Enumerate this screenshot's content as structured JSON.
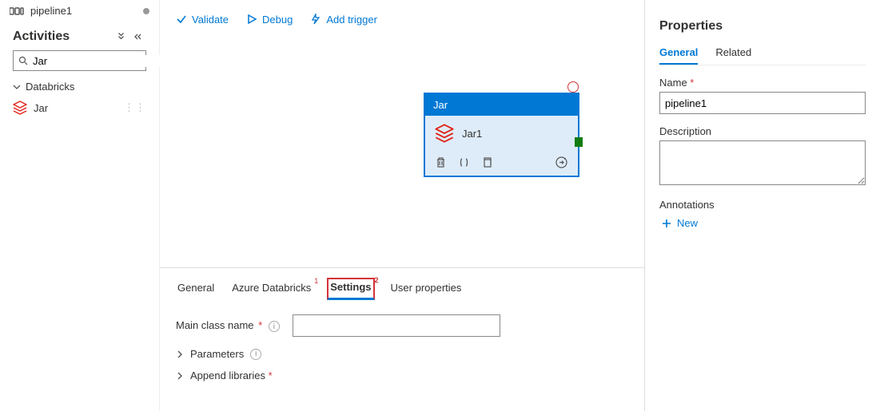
{
  "header_tab": {
    "title": "pipeline1"
  },
  "sidebar": {
    "title": "Activities",
    "search_value": "Jar",
    "group": "Databricks",
    "items": [
      {
        "label": "Jar"
      }
    ]
  },
  "toolbar": {
    "validate": "Validate",
    "debug": "Debug",
    "add_trigger": "Add trigger"
  },
  "canvas": {
    "node_type": "Jar",
    "node_name": "Jar1"
  },
  "bottom": {
    "tabs": {
      "general": "General",
      "azure_databricks": "Azure Databricks",
      "settings": "Settings",
      "user_properties": "User properties",
      "badge_adb": "1",
      "badge_settings": "2"
    },
    "settings": {
      "main_class_label": "Main class name",
      "main_class_value": "",
      "parameters_label": "Parameters",
      "append_libs_label": "Append libraries"
    }
  },
  "properties": {
    "title": "Properties",
    "tabs": {
      "general": "General",
      "related": "Related"
    },
    "name_label": "Name",
    "name_value": "pipeline1",
    "description_label": "Description",
    "description_value": "",
    "annotations_label": "Annotations",
    "new_label": "New"
  }
}
